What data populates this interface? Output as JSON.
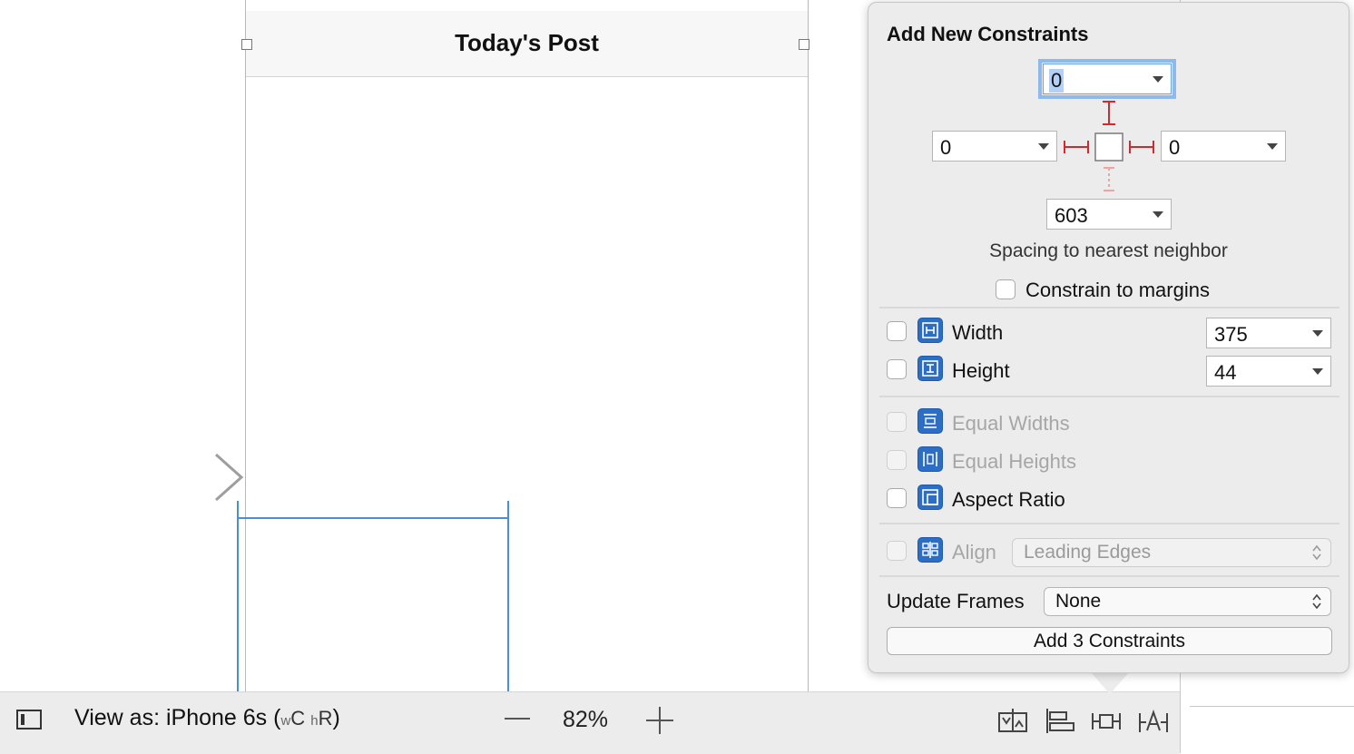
{
  "canvas": {
    "navbar_title": "Today's Post"
  },
  "bottom_bar": {
    "view_as_prefix": "View as: iPhone 6s (",
    "size_w": "w",
    "size_c": "C ",
    "size_h": "h",
    "size_r": "R",
    "view_as_suffix": ")",
    "zoom": "82%"
  },
  "constraints_popover": {
    "title": "Add New Constraints",
    "spacing": {
      "top": "0",
      "left": "0",
      "right": "0",
      "bottom": "603"
    },
    "spacing_caption": "Spacing to nearest neighbor",
    "constrain_to_margins": {
      "label": "Constrain to margins",
      "checked": false
    },
    "width": {
      "label": "Width",
      "value": "375",
      "checked": false
    },
    "height": {
      "label": "Height",
      "value": "44",
      "checked": false
    },
    "equal_widths": {
      "label": "Equal Widths",
      "enabled": false
    },
    "equal_heights": {
      "label": "Equal Heights",
      "enabled": false
    },
    "aspect_ratio": {
      "label": "Aspect Ratio",
      "checked": false
    },
    "align": {
      "label": "Align",
      "value": "Leading Edges",
      "enabled": false
    },
    "update_frames": {
      "label": "Update Frames",
      "value": "None"
    },
    "add_button": "Add 3 Constraints"
  },
  "colors": {
    "accent": "#2c6ec5",
    "constraint_red": "#d9262b",
    "focus_ring": "#8db9ec",
    "frame_blue": "#4a8fd6"
  },
  "icons": [
    "sidebar-toggle-icon",
    "stack-icon",
    "align-icon",
    "pin-icon",
    "resolve-issues-icon",
    "width-icon",
    "height-icon",
    "equal-widths-icon",
    "equal-heights-icon",
    "aspect-ratio-icon",
    "align-icon"
  ]
}
